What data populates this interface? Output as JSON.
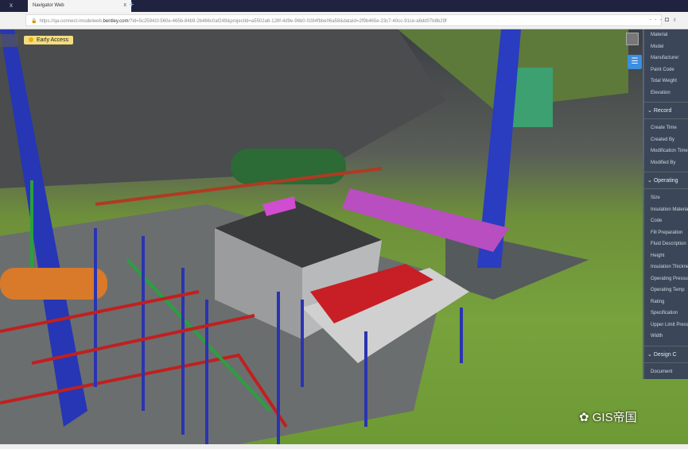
{
  "browser": {
    "tab_title": "Navigator Web",
    "tab_close": "x",
    "new_tab": "+",
    "url_prefix": "https://qa-connect-imodelweb.",
    "url_domain": "bentley.com",
    "url_rest": "/?id=5c25941f-560e-465b-84b9-2b466c0af249&projectId=a5502a6-128f-4d9e-96b0-0284fbbe06a58&dataId=2f9b465e-23c7-40cc-91ce-a6dd07b8b29f",
    "menu": "···"
  },
  "viewer": {
    "early_access": "Early Access",
    "list_icon": "☰"
  },
  "properties_panel": {
    "items_top": [
      "Material",
      "Model",
      "Manufacturer",
      "Paint Code",
      "Total Weight",
      "Elevation"
    ],
    "sections": [
      {
        "title": "Record",
        "items": [
          "Create Time",
          "Created By",
          "Modification Time",
          "Modified By"
        ]
      },
      {
        "title": "Operating",
        "items": [
          "Size",
          "Insulation Material",
          "Code",
          "Fill Preparation",
          "Fluid Description",
          "Height",
          "Insulation Thickness",
          "Operating Pressure",
          "Operating Temp",
          "Rating",
          "Specification",
          "Upper Limit Pressure",
          "Width"
        ]
      },
      {
        "title": "Design C",
        "items": [
          "Document"
        ]
      }
    ]
  },
  "watermark": "GIS帝国"
}
